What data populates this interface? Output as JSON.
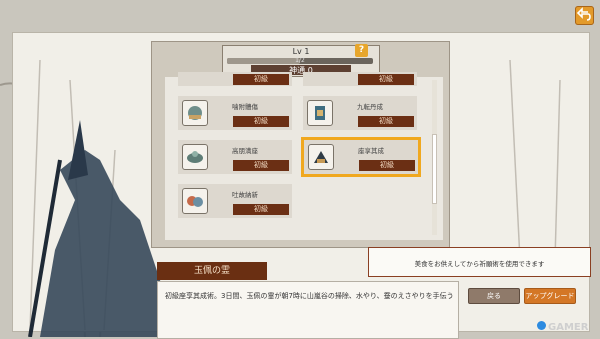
{
  "level": {
    "title": "Lv 1",
    "progress_text": "1/2",
    "progress_fraction": 0.5,
    "subtitle": "神通 0"
  },
  "help_label": "?",
  "skills": [
    {
      "name": "",
      "rank": "初級",
      "icon": "skill-scroll-icon"
    },
    {
      "name": "",
      "rank": "初級",
      "icon": "skill-scroll-icon"
    },
    {
      "name": "噛附體傷",
      "rank": "初級",
      "icon": "skill-scroll-icon"
    },
    {
      "name": "九転丹成",
      "rank": "初級",
      "icon": "skill-scroll-icon"
    },
    {
      "name": "高朋満座",
      "rank": "初級",
      "icon": "skill-scroll-icon"
    },
    {
      "name": "座享其成",
      "rank": "初級",
      "icon": "skill-scroll-icon",
      "selected": true
    },
    {
      "name": "吐故納新",
      "rank": "初級",
      "icon": "skill-scroll-icon"
    }
  ],
  "dialog": {
    "title": "玉佩の霊",
    "text": "初級座享其成術。3日間、玉佩の霊が朝7時に山嵐谷の掃除、水やり、蚕のえさやりを手伝う"
  },
  "notice": "美食をお供えしてから祈願術を使用できます",
  "buttons": {
    "back": "戻る",
    "upgrade": "アップグレード"
  },
  "watermark": "GAMER",
  "colors": {
    "accent": "#f0a81f",
    "rank_bg": "#6b2f14",
    "upgrade": "#d47726"
  }
}
